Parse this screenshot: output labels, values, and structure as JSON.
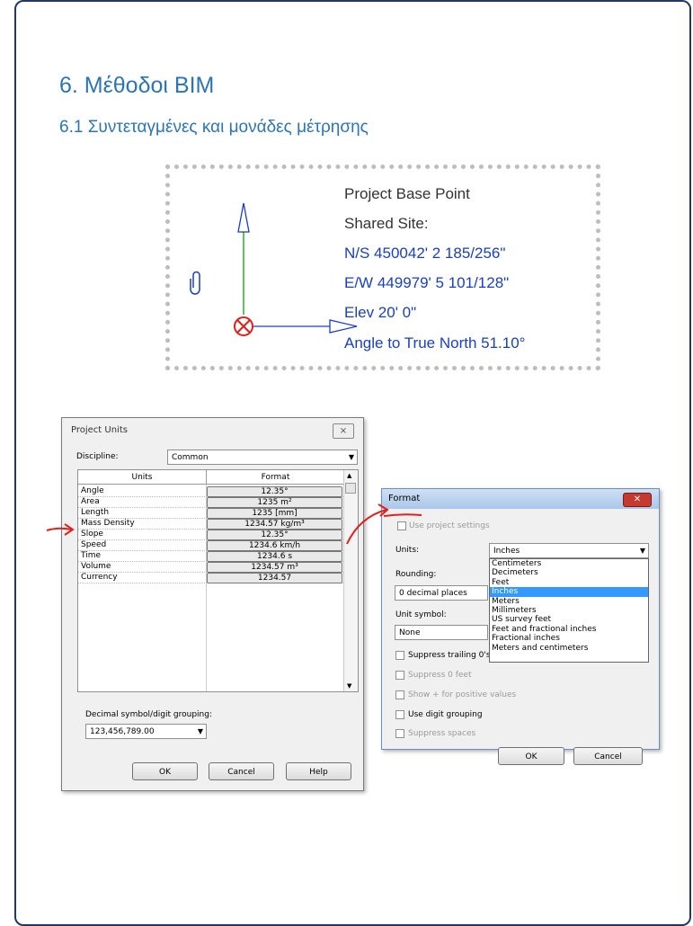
{
  "page": {
    "heading": "6. Μέθοδοι BIM",
    "subheading": "6.1 Συντεταγμένες και μονάδες μέτρησης"
  },
  "base_point": {
    "lines": [
      "Project Base Point",
      "Shared Site:",
      "N/S  450042'  2 185/256\"",
      "E/W  449979'  5 101/128\"",
      "Elev  20'  0\"",
      "Angle to True North  51.10°"
    ]
  },
  "project_units": {
    "title": "Project Units",
    "close": "⨯",
    "discipline_label": "Discipline:",
    "discipline_value": "Common",
    "columns": [
      "Units",
      "Format"
    ],
    "rows": [
      {
        "unit": "Angle",
        "format": "12.35°"
      },
      {
        "unit": "Area",
        "format": "1235 m²"
      },
      {
        "unit": "Length",
        "format": "1235 [mm]"
      },
      {
        "unit": "Mass Density",
        "format": "1234.57 kg/m³"
      },
      {
        "unit": "Slope",
        "format": "12.35°"
      },
      {
        "unit": "Speed",
        "format": "1234.6 km/h"
      },
      {
        "unit": "Time",
        "format": "1234.6 s"
      },
      {
        "unit": "Volume",
        "format": "1234.57 m³"
      },
      {
        "unit": "Currency",
        "format": "1234.57"
      }
    ],
    "decimal_label": "Decimal symbol/digit grouping:",
    "decimal_value": "123,456,789.00",
    "ok": "OK",
    "cancel": "Cancel",
    "help": "Help"
  },
  "format_dialog": {
    "title": "Format",
    "close": "✕",
    "use_project_settings": "Use project settings",
    "units_label": "Units:",
    "units_value": "Inches",
    "unit_options": [
      "Centimeters",
      "Decimeters",
      "Feet",
      "Inches",
      "Meters",
      "Millimeters",
      "US survey feet",
      "Feet and fractional inches",
      "Fractional inches",
      "Meters and centimeters"
    ],
    "selected_option": "Inches",
    "rounding_label": "Rounding:",
    "rounding_value": "0 decimal places",
    "unit_symbol_label": "Unit symbol:",
    "unit_symbol_value": "None",
    "suppress_trailing": "Suppress trailing 0's",
    "suppress_zero_feet": "Suppress 0 feet",
    "show_plus": "Show + for positive values",
    "use_digit_grouping": "Use digit grouping",
    "suppress_spaces": "Suppress spaces",
    "ok": "OK",
    "cancel": "Cancel"
  },
  "colors": {
    "heading": "#2e74b5",
    "annotation_red": "#e0201b",
    "selection": "#3399ff"
  }
}
